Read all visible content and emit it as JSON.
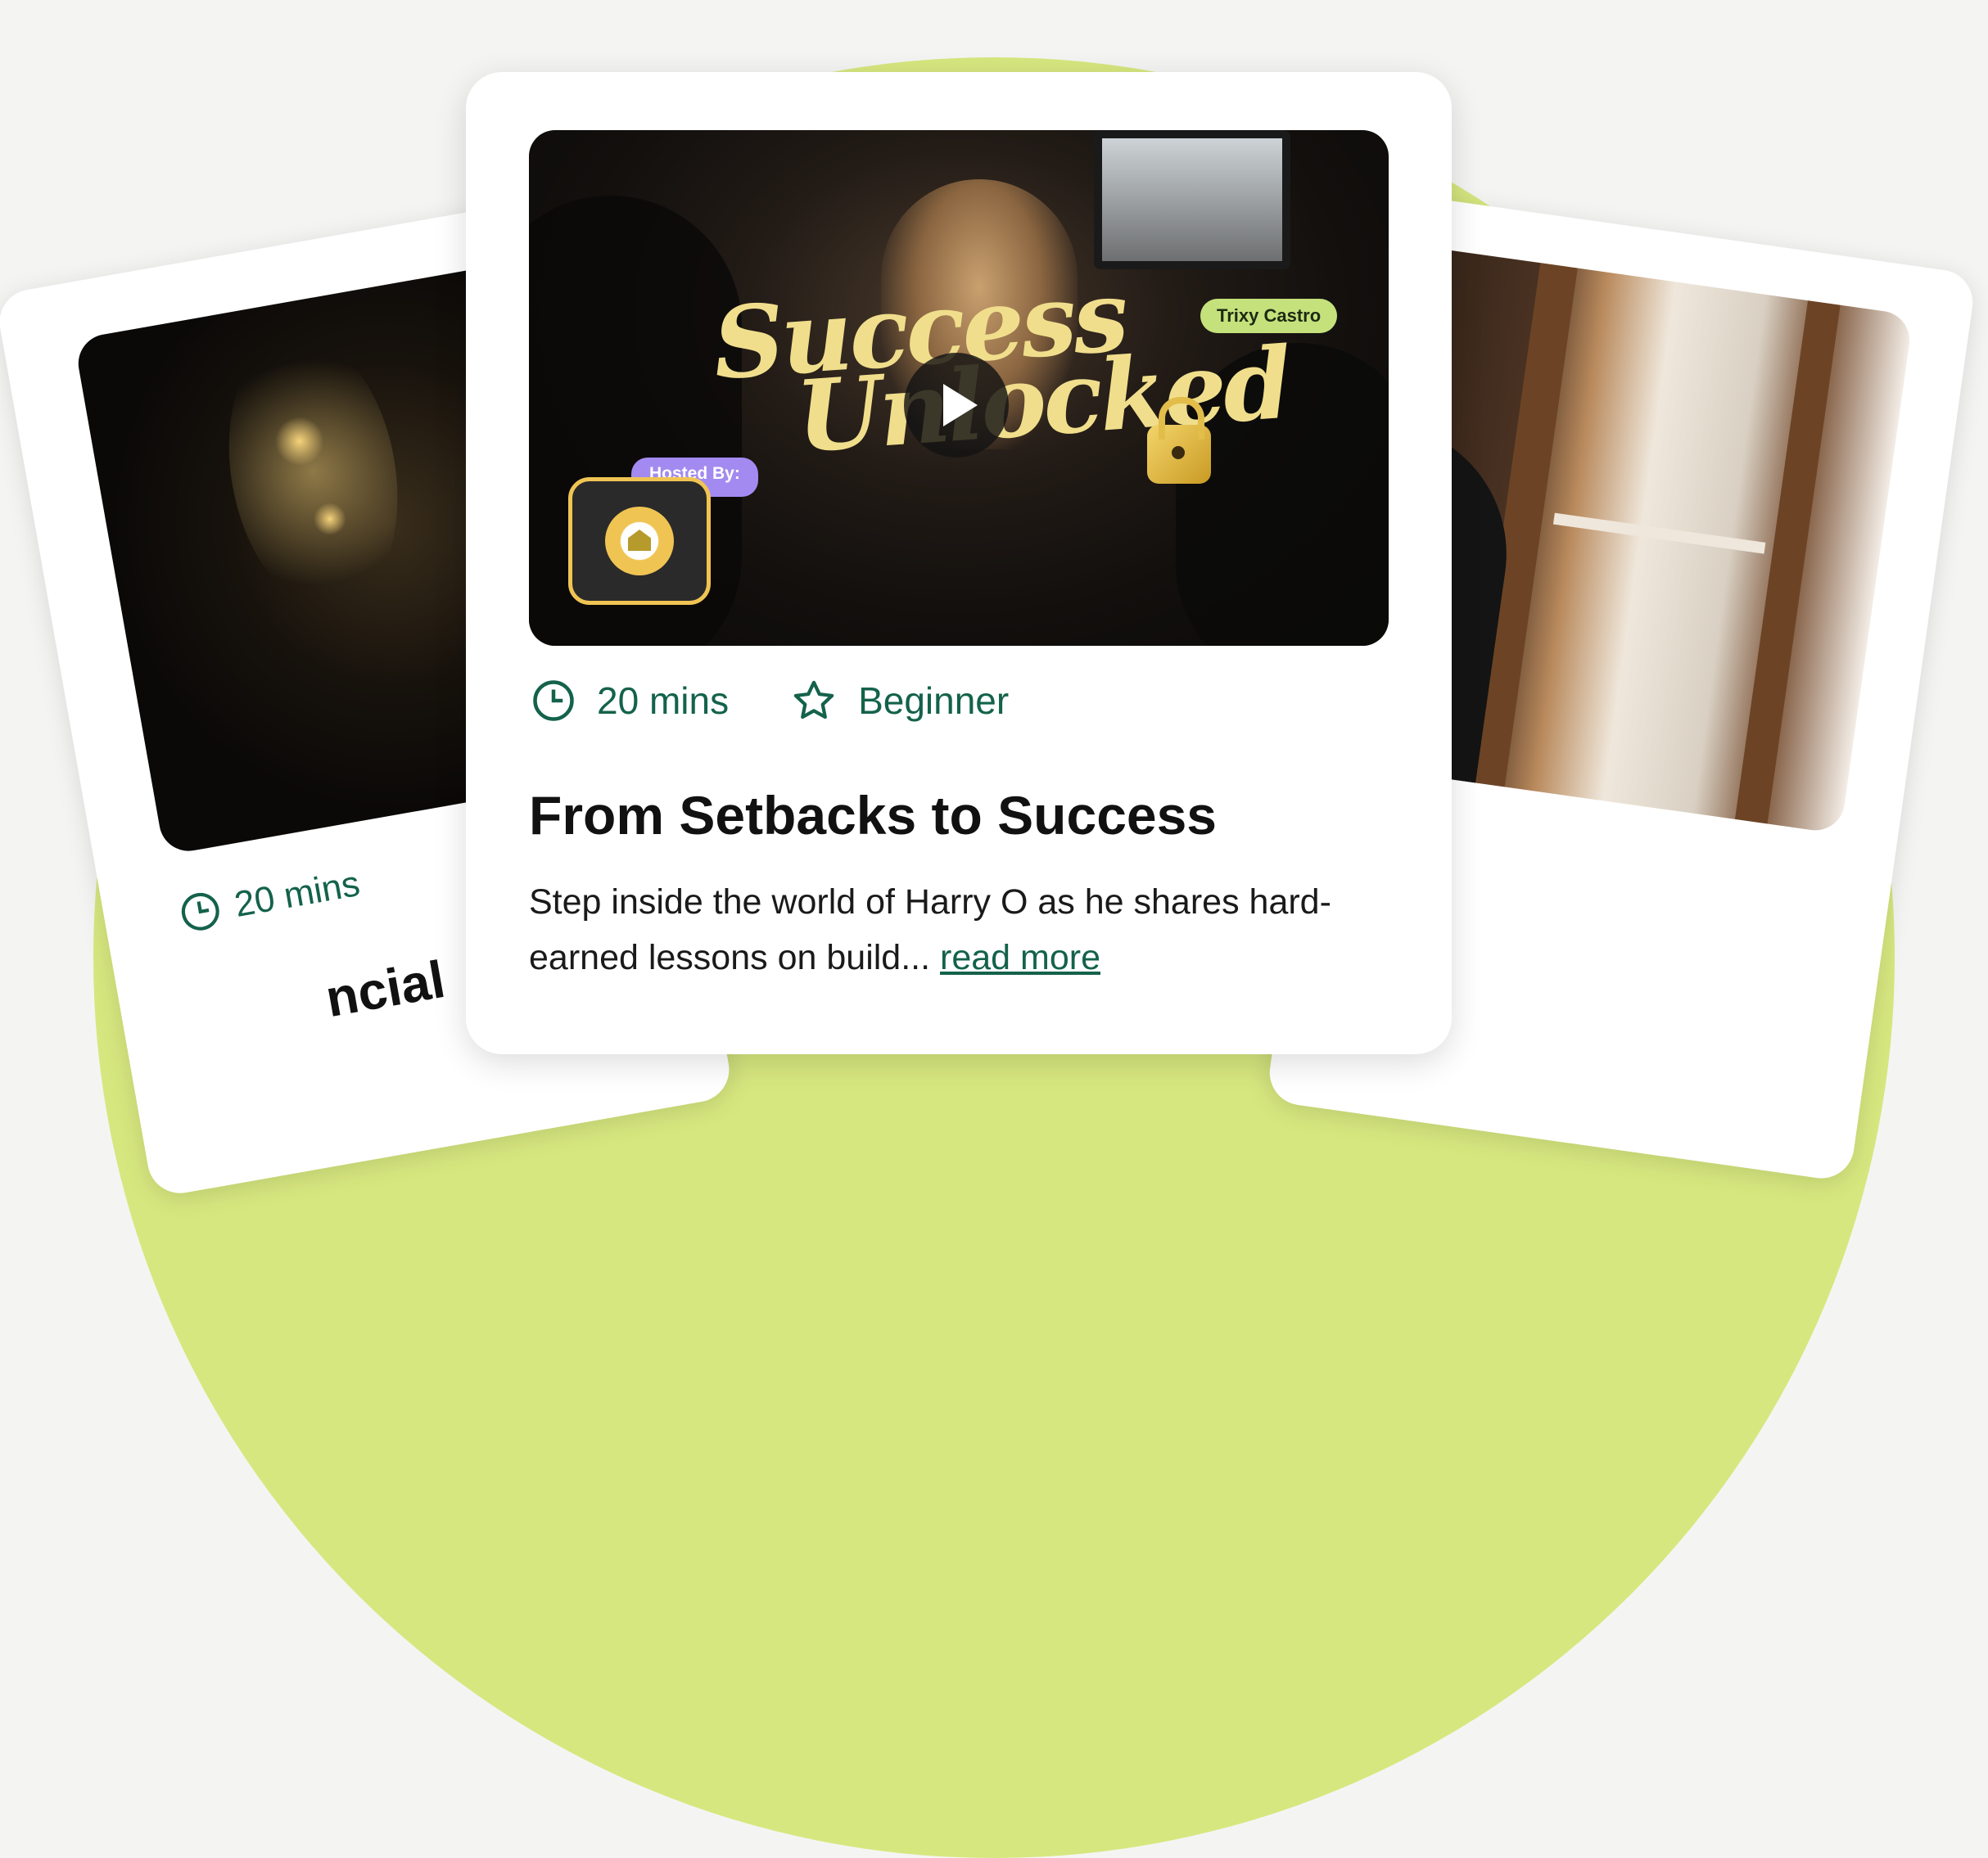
{
  "left_card": {
    "duration": "20 mins",
    "title_peek": "ncial"
  },
  "center_card": {
    "video": {
      "logo_line1": "Success",
      "logo_line2": "Unlocked",
      "host_name": "Trixy Castro",
      "hosted_by": "Hosted By:"
    },
    "duration": "20 mins",
    "level": "Beginner",
    "title": "From Setbacks to Success",
    "description": "Step inside the world of Harry O as he shares hard-earned lessons on build...",
    "read_more": "read more"
  },
  "colors": {
    "accent_green": "#14624b",
    "lime_background": "#d7e77f",
    "host_tag": "#c5e17c",
    "hosted_pill": "#a38af0",
    "gold": "#f0c453"
  },
  "icons": {
    "duration": "clock-icon",
    "level": "star-icon",
    "play": "play-icon",
    "lock": "lock-icon"
  }
}
